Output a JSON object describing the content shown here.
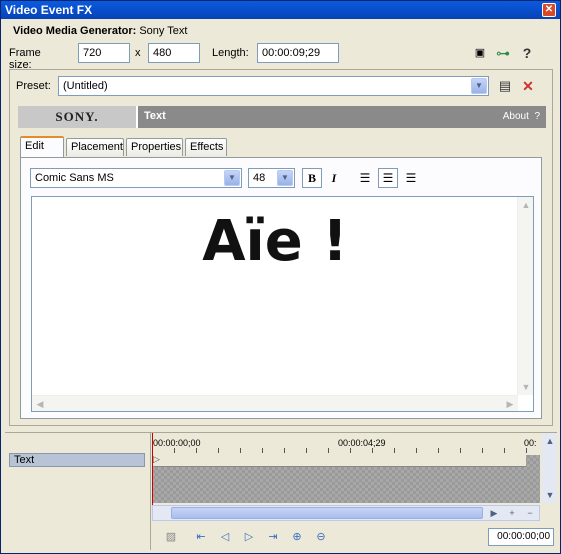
{
  "window": {
    "title": "Video Event FX",
    "close_glyph": "✕"
  },
  "generator": {
    "label": "Video Media Generator:",
    "value": "Sony Text"
  },
  "frame": {
    "size_label": "Frame size:",
    "width": "720",
    "separator": "x",
    "height": "480",
    "length_label": "Length:",
    "length": "00:00:09;29"
  },
  "toolbar_icons": [
    "cursor-select-icon",
    "plugin-chain-icon",
    "help-icon"
  ],
  "preset": {
    "label": "Preset:",
    "value": "(Untitled)",
    "icons": [
      "save-icon",
      "delete-icon"
    ]
  },
  "plugin_header": {
    "logo": "SONY.",
    "title": "Text",
    "about": "About",
    "help": "?"
  },
  "tabs": [
    {
      "label": "Edit",
      "active": true
    },
    {
      "label": "Placement",
      "active": false
    },
    {
      "label": "Properties",
      "active": false
    },
    {
      "label": "Effects",
      "active": false
    }
  ],
  "format": {
    "font": "Comic Sans MS",
    "size": "48",
    "bold": "B",
    "italic": "I",
    "alignment": "center"
  },
  "editor": {
    "text": "Aïe !"
  },
  "timeline": {
    "track_name": "Text",
    "ruler_labels": [
      "00:00:00;00",
      "00:00:04;29",
      "00:"
    ],
    "timecode": "00:00:00;00"
  },
  "colors": {
    "title_bar": "#0A5BE0",
    "sony_bar": "#8A8A8A",
    "active_tab_accent": "#E68B2C",
    "close_button": "#D64A2A"
  }
}
